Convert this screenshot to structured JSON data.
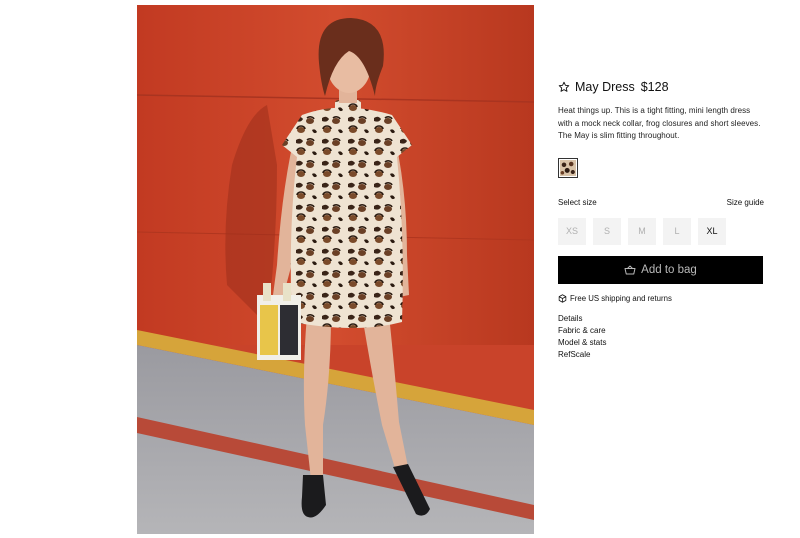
{
  "product": {
    "name": "May Dress",
    "price": "$128",
    "description": "Heat things up. This is a tight fitting, mini length dress with a mock neck collar, frog closures and short sleeves. The May is slim fitting throughout.",
    "swatch_pattern": "leopard"
  },
  "size": {
    "select_label": "Select size",
    "guide_label": "Size guide",
    "options": [
      "XS",
      "S",
      "M",
      "L",
      "XL"
    ],
    "available": [
      "XL"
    ]
  },
  "cta": {
    "add_to_bag": "Add to bag"
  },
  "shipping": {
    "text": "Free US shipping and returns"
  },
  "links": [
    "Details",
    "Fabric & care",
    "Model & stats",
    "RefScale"
  ],
  "colors": {
    "cta_bg": "#000000",
    "wall": "#c9432a",
    "size_bg": "#f3f3f3"
  },
  "icons": {
    "favorite": "star-outline-icon",
    "bag": "basket-icon",
    "shipping": "box-icon"
  }
}
